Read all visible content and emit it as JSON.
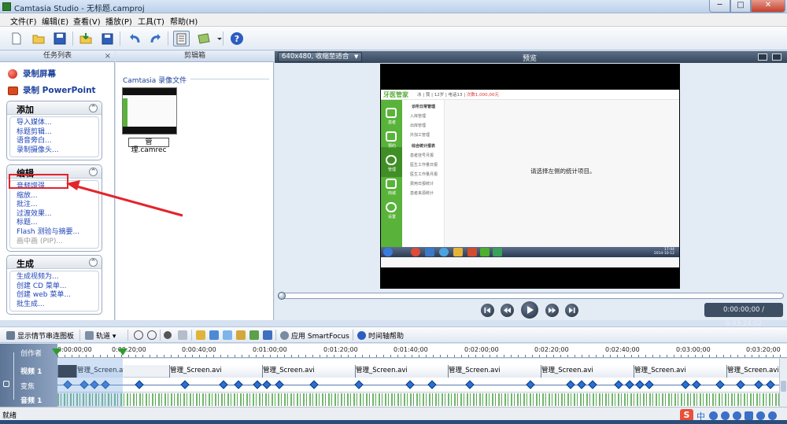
{
  "window": {
    "title": "Camtasia Studio - 无标题.camproj",
    "minimize": "─",
    "maximize": "□",
    "close": "✕"
  },
  "menu": [
    "文件(F)",
    "编辑(E)",
    "查看(V)",
    "播放(P)",
    "工具(T)",
    "帮助(H)"
  ],
  "toolbar_icons": [
    "new-icon",
    "open-icon",
    "save-icon",
    "import-icon",
    "save-all-icon",
    "undo-icon",
    "redo-icon",
    "task-list-icon",
    "produce-icon",
    "dropdown-icon",
    "help-icon"
  ],
  "tasklist": {
    "title": "任务列表",
    "close": "×",
    "record_screen": "录制屏幕",
    "record_ppt": "录制 PowerPoint",
    "groups": [
      {
        "title": "添加",
        "items": [
          {
            "label": "导入媒体..."
          },
          {
            "label": "标题剪辑..."
          },
          {
            "label": "语音旁白..."
          },
          {
            "label": "录制摄像头..."
          }
        ]
      },
      {
        "title": "编辑",
        "items": [
          {
            "label": "音频增强..."
          },
          {
            "label": "缩放..."
          },
          {
            "label": "批注..."
          },
          {
            "label": "过渡效果..."
          },
          {
            "label": "标题..."
          },
          {
            "label": "Flash 测验与摘要..."
          },
          {
            "label": "画中画 (PIP)..."
          }
        ]
      },
      {
        "title": "生成",
        "items": [
          {
            "label": "生成视频为..."
          },
          {
            "label": "创建 CD 菜单..."
          },
          {
            "label": "创建 web 菜单..."
          },
          {
            "label": "批生成..."
          }
        ]
      }
    ],
    "collapse_glyph": "^"
  },
  "clipbin": {
    "title": "剪辑箱",
    "section": "Camtasia 录像文件",
    "clip_label": "管理.camrec"
  },
  "preview": {
    "title": "预览",
    "size_select": "640x480, 收缩至适合",
    "size_caret": "▼",
    "screen": {
      "logo": "牙医管家",
      "info_left": "冰 | 我 | 12岁 | 电话13 | ",
      "info_right": "次数1,000,00元",
      "menu": [
        "诊所日常管理",
        "入库管理",
        "出库管理",
        "外加工管理",
        "综合统计报表",
        "患者挂号月报",
        "医生工作量日报",
        "医生工作量月报",
        "费用日报统计",
        "患者来源统计"
      ],
      "nav": [
        "患者",
        "预约",
        "管理",
        "商城",
        "设置"
      ],
      "message": "请选择左侧的统计项目。",
      "clock": "17:44\n2014-10-12"
    },
    "time": "0:00:00;00 / 0:03:24;02"
  },
  "timeline": {
    "toolbar": {
      "storyboard": "显示情节串连图板",
      "tracks": "轨道",
      "smartfocus": "应用 SmartFocus",
      "help": "时间轴帮助"
    },
    "ruler": [
      {
        "t": "0:00:00;00"
      },
      {
        "t": "0:00:20;00"
      },
      {
        "t": "0:00:40;00"
      },
      {
        "t": "0:01:00;00"
      },
      {
        "t": "0:01:20;00"
      },
      {
        "t": "0:01:40;00"
      },
      {
        "t": "0:02:00;00"
      },
      {
        "t": "0:02:20;00"
      },
      {
        "t": "0:02:40;00"
      },
      {
        "t": "0:03:00;00"
      },
      {
        "t": "0:03:20;00"
      }
    ],
    "track_headers": {
      "creator": "创作者",
      "video": "视频 1",
      "zoom": "变焦",
      "audio": "音频 1"
    },
    "clips": [
      {
        "label": "管理_Screen.avi"
      },
      {
        "label": "管理_Screen.avi"
      },
      {
        "label": "管理_Screen.avi"
      },
      {
        "label": "管理_Screen.avi"
      },
      {
        "label": "管理_Screen.avi"
      },
      {
        "label": "管理_Screen.avi"
      },
      {
        "label": "管理_Screen.avi"
      },
      {
        "label": "管理_Screen.avi"
      }
    ],
    "zoom_keyframes_count": 30
  },
  "status": {
    "text": "就绪",
    "ime_logo": "S",
    "ime_mode": "中"
  },
  "colors": {
    "accent_blue": "#1f45b8",
    "highlight_red": "#e3242b",
    "playhead_green": "#2e9b2e"
  }
}
